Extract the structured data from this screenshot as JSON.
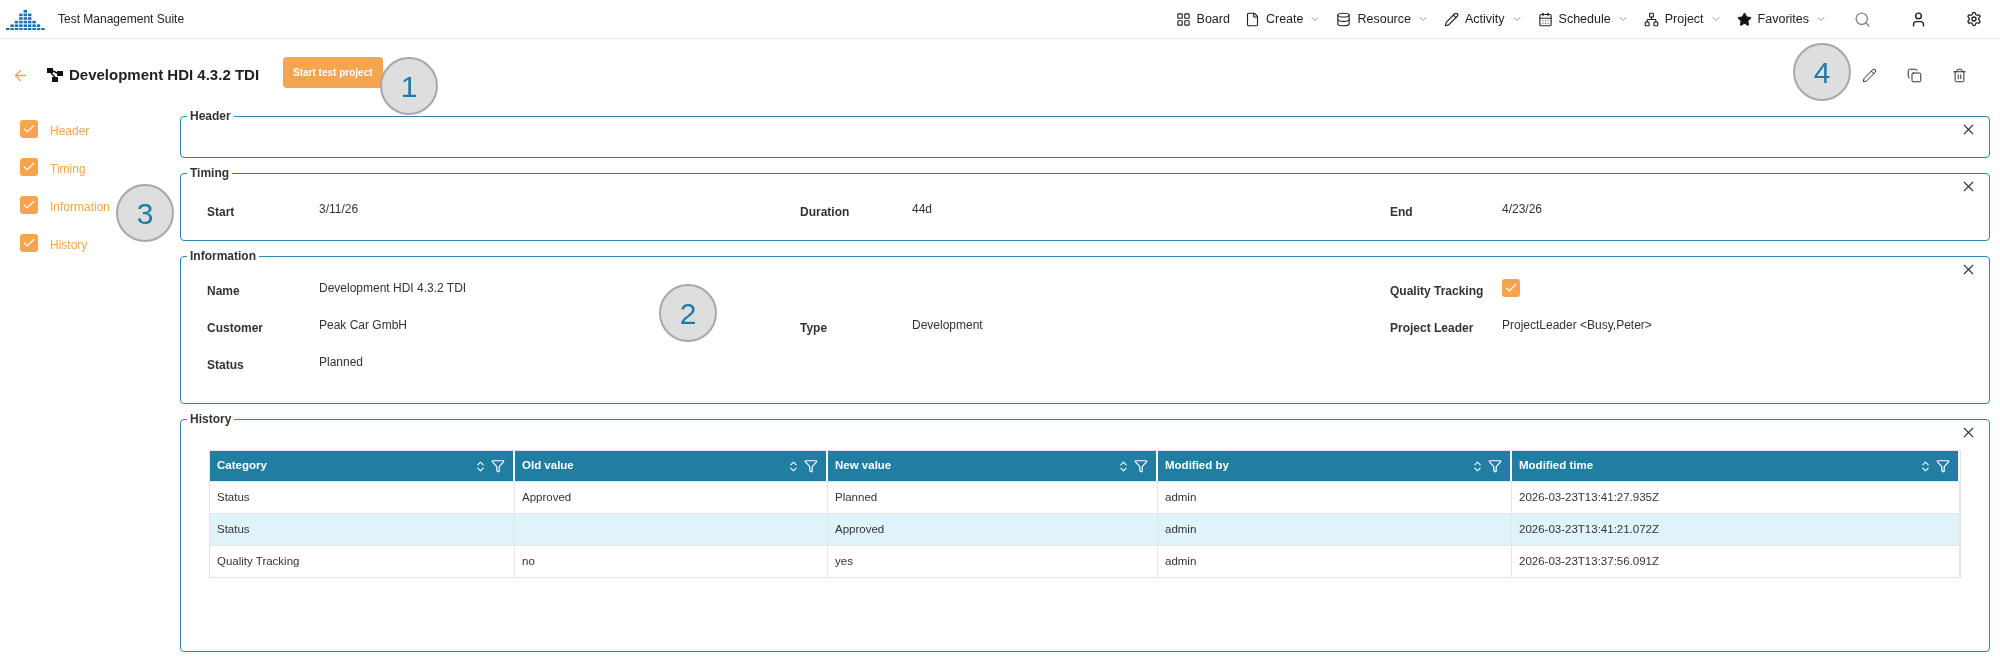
{
  "app": {
    "title": "Test Management Suite"
  },
  "nav": [
    {
      "label": "Board",
      "dropdown": false
    },
    {
      "label": "Create",
      "dropdown": true
    },
    {
      "label": "Resource",
      "dropdown": true
    },
    {
      "label": "Activity",
      "dropdown": true
    },
    {
      "label": "Schedule",
      "dropdown": true
    },
    {
      "label": "Project",
      "dropdown": true
    },
    {
      "label": "Favorites",
      "dropdown": true
    }
  ],
  "page": {
    "title": "Development HDI 4.3.2 TDI",
    "action_button": "Start test project"
  },
  "sections": [
    {
      "label": "Header",
      "checked": true
    },
    {
      "label": "Timing",
      "checked": true
    },
    {
      "label": "Information",
      "checked": true
    },
    {
      "label": "History",
      "checked": true
    }
  ],
  "header_panel": {
    "title": "Header"
  },
  "timing_panel": {
    "title": "Timing",
    "fields": [
      {
        "label": "Start",
        "value": "3/11/26"
      },
      {
        "label": "Duration",
        "value": "44d"
      },
      {
        "label": "End",
        "value": "4/23/26"
      }
    ]
  },
  "information_panel": {
    "title": "Information",
    "rows": [
      [
        {
          "kind": "text",
          "label": "Name",
          "value": "Development HDI 4.3.2 TDI"
        },
        null,
        {
          "kind": "checkbox",
          "label": "Quality Tracking",
          "checked": true
        }
      ],
      [
        {
          "kind": "text",
          "label": "Customer",
          "value": "Peak Car GmbH"
        },
        {
          "kind": "text",
          "label": "Type",
          "value": "Development"
        },
        {
          "kind": "text",
          "label": "Project Leader",
          "value": "ProjectLeader <Busy,Peter>"
        }
      ],
      [
        {
          "kind": "text",
          "label": "Status",
          "value": "Planned"
        },
        null,
        null
      ]
    ]
  },
  "history_panel": {
    "title": "History",
    "table": {
      "columns": [
        "Category",
        "Old value",
        "New value",
        "Modified by",
        "Modified time"
      ],
      "rows": [
        {
          "cells": [
            "Status",
            "Approved",
            "Planned",
            "admin",
            "2026-03-23T13:41:27.935Z"
          ],
          "selected": false
        },
        {
          "cells": [
            "Status",
            "",
            "Approved",
            "admin",
            "2026-03-23T13:41:21.072Z"
          ],
          "selected": true
        },
        {
          "cells": [
            "Quality Tracking",
            "no",
            "yes",
            "admin",
            "2026-03-23T13:37:56.091Z"
          ],
          "selected": false
        }
      ]
    }
  },
  "callouts": [
    "1",
    "2",
    "3",
    "4"
  ]
}
